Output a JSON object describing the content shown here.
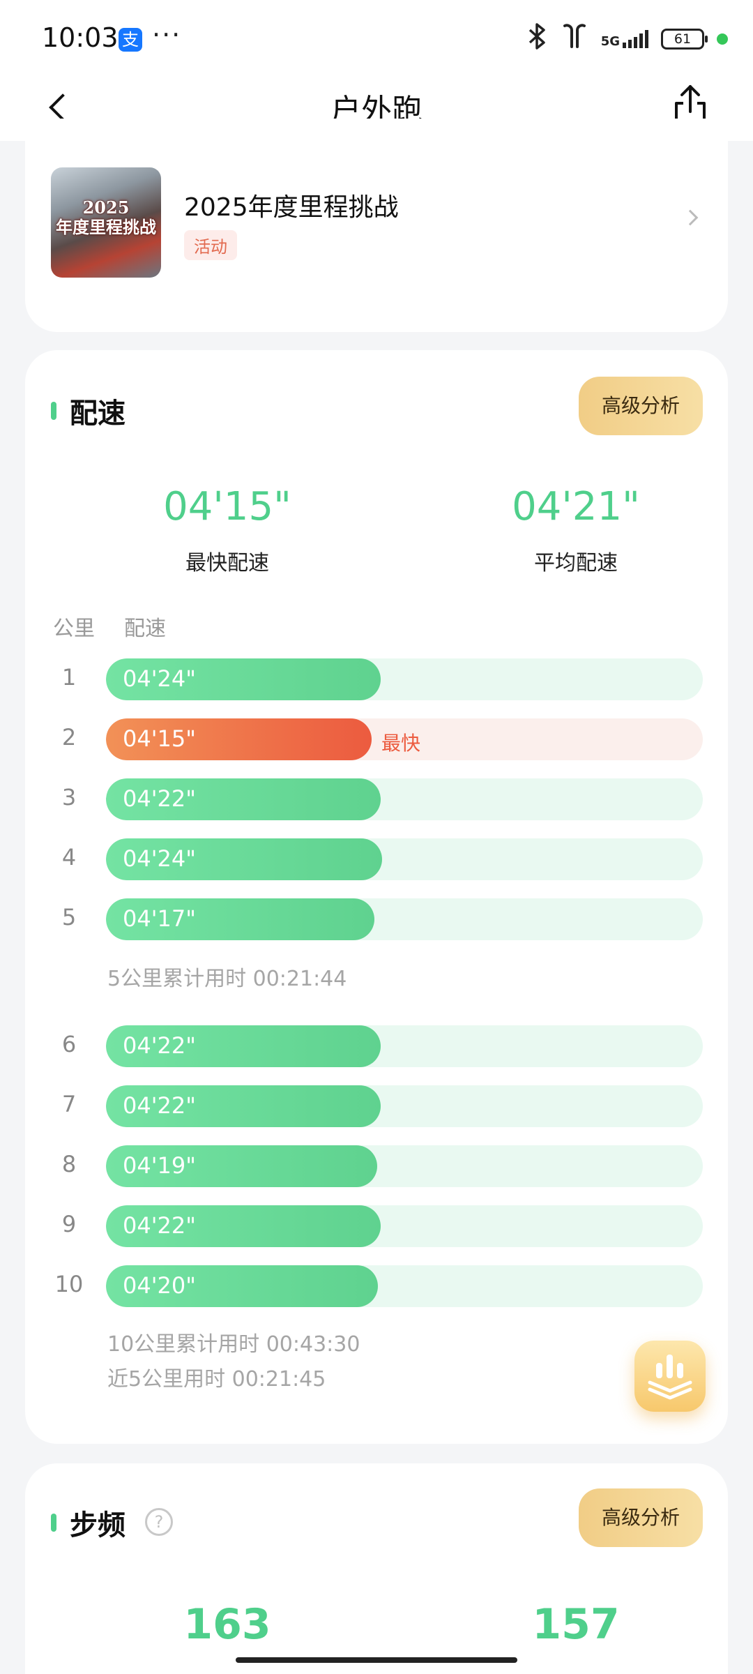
{
  "status_bar": {
    "time": "10:03",
    "alipay_icon_char": "支",
    "more": "···",
    "network": "5G",
    "battery": "61"
  },
  "nav": {
    "title": "户外跑"
  },
  "activity": {
    "thumbnail_text": "2025\n年度里程挑战",
    "title": "2025年度里程挑战",
    "tag": "活动"
  },
  "pace": {
    "title": "配速",
    "advanced_label": "高级分析",
    "fastest_value": "04'15\"",
    "fastest_label": "最快配速",
    "average_value": "04'21\"",
    "average_label": "平均配速",
    "col_km": "公里",
    "col_pace": "配速",
    "fastest_tag": "最快",
    "splits": [
      {
        "km": "1",
        "pace": "04'24\"",
        "fraction": 0.46,
        "fastest": false
      },
      {
        "km": "2",
        "pace": "04'15\"",
        "fraction": 0.445,
        "fastest": true
      },
      {
        "km": "3",
        "pace": "04'22\"",
        "fraction": 0.46,
        "fastest": false
      },
      {
        "km": "4",
        "pace": "04'24\"",
        "fraction": 0.463,
        "fastest": false
      },
      {
        "km": "5",
        "pace": "04'17\"",
        "fraction": 0.45,
        "fastest": false
      },
      {
        "km": "6",
        "pace": "04'22\"",
        "fraction": 0.46,
        "fastest": false
      },
      {
        "km": "7",
        "pace": "04'22\"",
        "fraction": 0.46,
        "fastest": false
      },
      {
        "km": "8",
        "pace": "04'19\"",
        "fraction": 0.454,
        "fastest": false
      },
      {
        "km": "9",
        "pace": "04'22\"",
        "fraction": 0.46,
        "fastest": false
      },
      {
        "km": "10",
        "pace": "04'20\"",
        "fraction": 0.456,
        "fastest": false
      }
    ],
    "cumulative_5": "5公里累计用时 00:21:44",
    "cumulative_10": "10公里累计用时 00:43:30",
    "recent_5": "近5公里用时 00:21:45"
  },
  "cadence": {
    "title": "步频",
    "help": "?",
    "advanced_label": "高级分析",
    "value_left": "163",
    "value_right": "157"
  }
}
